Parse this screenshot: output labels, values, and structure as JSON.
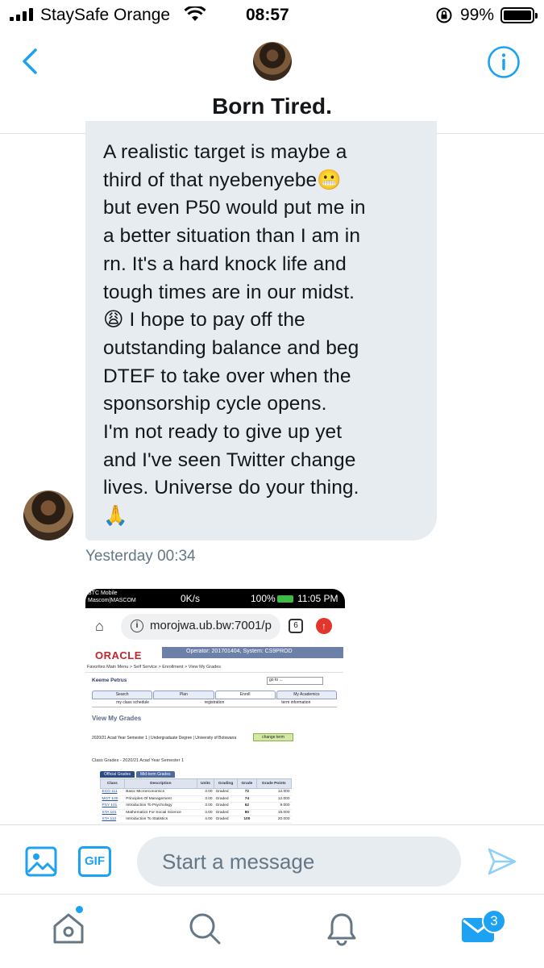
{
  "status_bar": {
    "carrier": "StaySafe Orange",
    "time": "08:57",
    "battery": "99%",
    "icons": [
      "signal-icon",
      "wifi-icon",
      "rotation-lock-icon",
      "battery-icon"
    ]
  },
  "header": {
    "title": "Born Tired.",
    "icons": [
      "back-icon",
      "info-icon"
    ]
  },
  "message": {
    "text": "A realistic target is maybe a\nthird of that nyebenyebe😬\nbut even P50 would put me in\na better situation than I am in\nrn. It's a hard knock life and\ntough times are in our midst.\n😩 I hope to pay off the\noutstanding balance and beg\nDTEF to take over when the\nsponsorship cycle opens.\nI'm not ready to give up yet\nand I've seen Twitter change\nlives. Universe do your thing.\n🙏",
    "timestamp": "Yesterday 00:34"
  },
  "attachment": {
    "phone_status": {
      "carrier": "BTC Mobile\nMascom|MASCOM",
      "speed": "0K/s",
      "battery": "100%",
      "time": "11:05 PM"
    },
    "url": "morojwa.ub.bw:7001/p",
    "tab_count": "6",
    "page": {
      "logo": "ORACLE",
      "operator": "Operator: 201701404, System: CS9PROD",
      "breadcrumb": "Favorites  Main Menu  >  Self Service  >  Enrollment  >  View My Grades",
      "user": "Keeme Petrus",
      "goto": "go to ...",
      "tabs": [
        "Search",
        "Plan",
        "Enroll",
        "My Academics"
      ],
      "subtabs": [
        "my class schedule",
        "registration",
        "term information"
      ],
      "heading": "View My Grades",
      "term": "2020/21 Acad Year Semester 1 | Undergraduate Degree | University of Botswana",
      "change_term": "change term",
      "class_grades": "Class Grades - 2020/21 Acad Year Semester 1",
      "grade_tabs": [
        "Official Grades",
        "Mid-term Grades"
      ],
      "columns": [
        "Class",
        "Description",
        "Units",
        "Grading",
        "Grade",
        "Grade Points"
      ],
      "rows": [
        [
          "ECO 111",
          "Basic Microeconomics",
          "3.00",
          "Graded",
          "72",
          "12.000"
        ],
        [
          "MGT 100",
          "Principles Of Management",
          "3.00",
          "Graded",
          "74",
          "12.000"
        ],
        [
          "PSY 101",
          "Introduction To Psychology",
          "3.00",
          "Graded",
          "62",
          "9.000"
        ],
        [
          "STA 101",
          "Mathematics For Social Science",
          "3.00",
          "Graded",
          "80",
          "15.000"
        ],
        [
          "STA 112",
          "Introduction To Statistics",
          "4.00",
          "Graded",
          "100",
          "20.000"
        ]
      ]
    }
  },
  "composer": {
    "placeholder": "Start a message",
    "gif_label": "GIF",
    "icons": [
      "image-icon",
      "gif-icon",
      "send-icon"
    ]
  },
  "tabbar": {
    "messages_badge": "3",
    "icons": [
      "home-icon",
      "search-icon",
      "notifications-icon",
      "messages-icon"
    ]
  },
  "colors": {
    "accent": "#1da1f2",
    "bubble": "#e6ecf0",
    "secondary_text": "#657786"
  }
}
